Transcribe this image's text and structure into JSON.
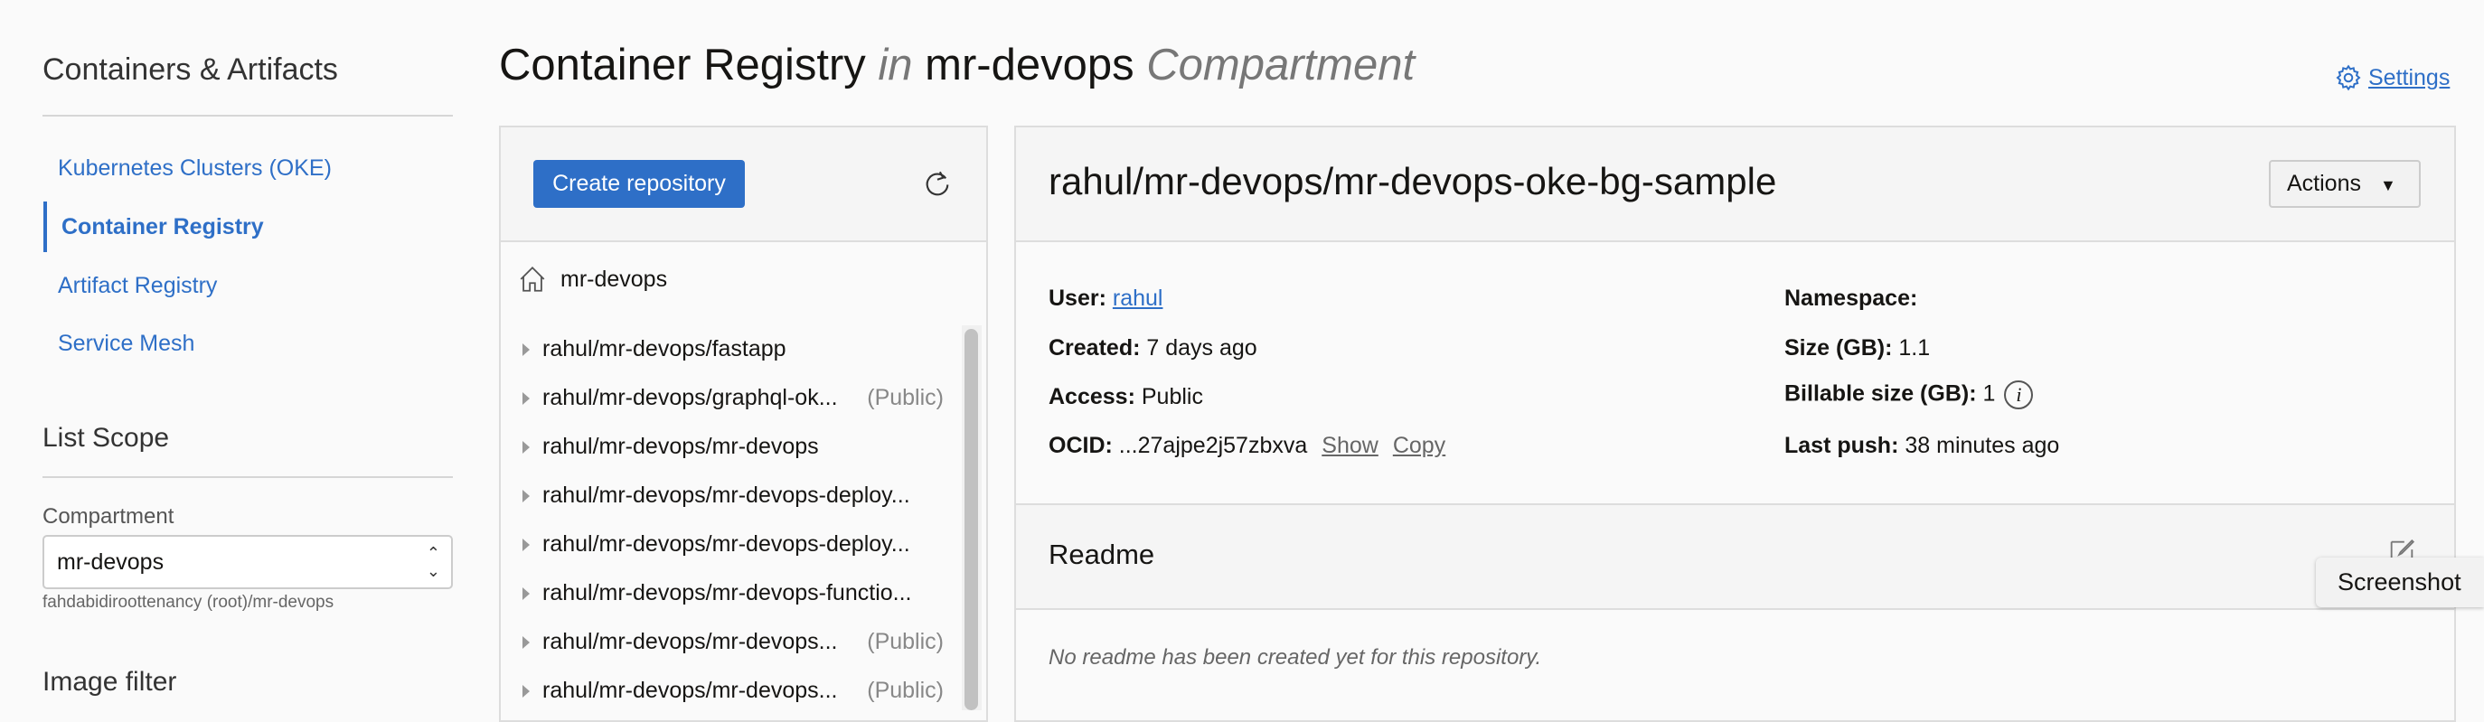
{
  "sidebar": {
    "title": "Containers & Artifacts",
    "items": [
      {
        "label": "Kubernetes Clusters (OKE)",
        "active": false
      },
      {
        "label": "Container Registry",
        "active": true
      },
      {
        "label": "Artifact Registry",
        "active": false
      },
      {
        "label": "Service Mesh",
        "active": false
      }
    ],
    "list_scope": {
      "title": "List Scope",
      "compartment_label": "Compartment",
      "compartment_value": "mr-devops",
      "compartment_path": "fahdabidiroottenancy (root)/mr-devops"
    },
    "image_filter_title": "Image filter"
  },
  "header": {
    "title_main": "Container Registry",
    "title_in": "in",
    "title_compartment": "mr-devops",
    "title_suffix": "Compartment",
    "settings_label": "Settings"
  },
  "repo_list": {
    "create_label": "Create repository",
    "root": "mr-devops",
    "items": [
      {
        "name": "rahul/mr-devops/fastapp",
        "badge": ""
      },
      {
        "name": "rahul/mr-devops/graphql-ok...",
        "badge": "(Public)"
      },
      {
        "name": "rahul/mr-devops/mr-devops",
        "badge": ""
      },
      {
        "name": "rahul/mr-devops/mr-devops-deploy...",
        "badge": ""
      },
      {
        "name": "rahul/mr-devops/mr-devops-deploy...",
        "badge": ""
      },
      {
        "name": "rahul/mr-devops/mr-devops-functio...",
        "badge": ""
      },
      {
        "name": "rahul/mr-devops/mr-devops...",
        "badge": "(Public)"
      },
      {
        "name": "rahul/mr-devops/mr-devops...",
        "badge": "(Public)"
      }
    ]
  },
  "detail": {
    "title": "rahul/mr-devops/mr-devops-oke-bg-sample",
    "actions_label": "Actions",
    "user_label": "User:",
    "user_value": "rahul",
    "created_label": "Created:",
    "created_value": "7 days ago",
    "access_label": "Access:",
    "access_value": "Public",
    "ocid_label": "OCID:",
    "ocid_value": "...27ajpe2j57zbxva",
    "show_label": "Show",
    "copy_label": "Copy",
    "namespace_label": "Namespace:",
    "size_label": "Size (GB):",
    "size_value": "1.1",
    "billable_label": "Billable size (GB):",
    "billable_value": "1",
    "last_push_label": "Last push:",
    "last_push_value": "38 minutes ago",
    "readme_title": "Readme",
    "readme_empty": "No readme has been created yet for this repository."
  },
  "tooltip": "Screenshot",
  "colors": {
    "accent": "#2e6fc7"
  }
}
